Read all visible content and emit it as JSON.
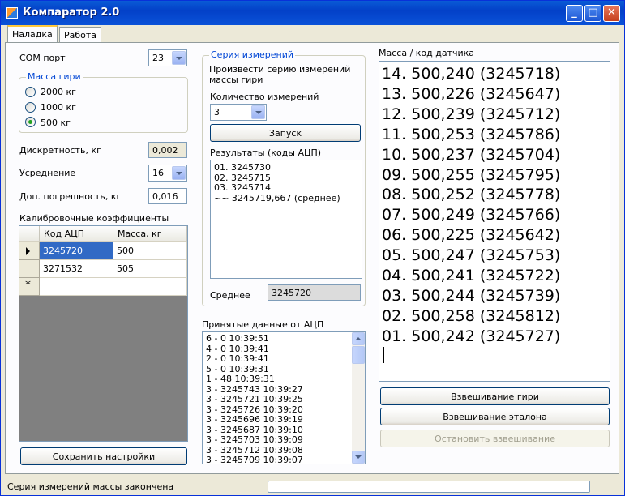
{
  "window": {
    "title": "Компаратор 2.0"
  },
  "tabs": [
    {
      "label": "Наладка"
    },
    {
      "label": "Работа"
    }
  ],
  "settings": {
    "com_port_label": "COM порт",
    "com_port_value": "23",
    "weight_group_title": "Масса гири",
    "weight_options": [
      {
        "label": "2000 кг",
        "checked": false
      },
      {
        "label": "1000 кг",
        "checked": false
      },
      {
        "label": "500 кг",
        "checked": true
      }
    ],
    "resolution_label": "Дискретность, кг",
    "resolution_value": "0,002",
    "averaging_label": "Усреднение",
    "averaging_value": "16",
    "tolerance_label": "Доп. погрешность, кг",
    "tolerance_value": "0,016",
    "calib_title": "Калибровочные коэффициенты",
    "calib_columns": [
      "Код АЦП",
      "Масса, кг"
    ],
    "calib_rows": [
      [
        "3245720",
        "500"
      ],
      [
        "3271532",
        "505"
      ]
    ],
    "save_button": "Сохранить настройки"
  },
  "series": {
    "group_title": "Серия измерений",
    "description": "Произвести серию измерений массы гири",
    "count_label": "Количество измерений",
    "count_value": "3",
    "start_button": "Запуск",
    "results_label": "Результаты (коды АЦП)",
    "results": [
      "01. 3245730",
      "02. 3245715",
      "03. 3245714",
      "~~ 3245719,667 (среднее)"
    ],
    "average_label": "Среднее",
    "average_value": "3245720"
  },
  "adc": {
    "label": "Принятые данные от АЦП",
    "lines": [
      "6 - 0 10:39:51",
      "4 - 0 10:39:41",
      "2 - 0 10:39:41",
      "5 - 0 10:39:31",
      "1 - 48 10:39:31",
      "3 - 3245743 10:39:27",
      "3 - 3245721 10:39:25",
      "3 - 3245726 10:39:20",
      "3 - 3245696 10:39:19",
      "3 - 3245687 10:39:10",
      "3 - 3245703 10:39:09",
      "3 - 3245712 10:39:08",
      "3 - 3245709 10:39:07"
    ]
  },
  "mass": {
    "label": "Масса / код датчика",
    "lines": [
      "14. 500,240 (3245718)",
      "13. 500,226 (3245647)",
      "12. 500,239 (3245712)",
      "11. 500,253 (3245786)",
      "10. 500,237 (3245704)",
      "09. 500,255 (3245795)",
      "08. 500,252 (3245778)",
      "07. 500,249 (3245766)",
      "06. 500,225 (3245642)",
      "05. 500,247 (3245753)",
      "04. 500,241 (3245722)",
      "03. 500,244 (3245739)",
      "02. 500,258 (3245812)",
      "01. 500,242 (3245727)"
    ],
    "weigh_weight_button": "Взвешивание гири",
    "weigh_reference_button": "Взвешивание эталона",
    "stop_button": "Остановить взвешивание"
  },
  "status": {
    "text": "Серия измерений массы закончена"
  }
}
